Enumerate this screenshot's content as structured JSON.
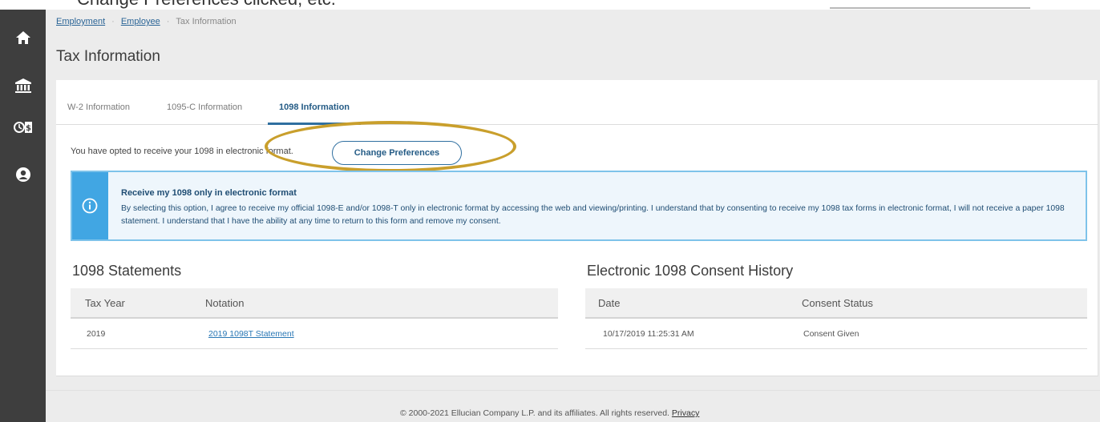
{
  "top_cropped_text": "Change Preferences clicked, etc.",
  "breadcrumb": {
    "items": [
      "Employment",
      "Employee"
    ],
    "current": "Tax Information"
  },
  "page_title": "Tax Information",
  "tabs": [
    {
      "label": "W-2 Information",
      "active": false
    },
    {
      "label": "1095-C Information",
      "active": false
    },
    {
      "label": "1098 Information",
      "active": true
    }
  ],
  "optin": {
    "text": "You have opted to receive your 1098 in electronic format.",
    "button_label": "Change Preferences"
  },
  "info": {
    "icon": "info-icon",
    "title": "Receive my 1098 only in electronic format",
    "body": "By selecting this option, I agree to receive my official 1098-E and/or 1098-T only in electronic format by accessing the web and viewing/printing. I understand that by consenting to receive my 1098 tax forms in electronic format, I will not receive a paper 1098 statement. I understand that I have the ability at any time to return to this form and remove my consent."
  },
  "statements": {
    "title": "1098 Statements",
    "headers": [
      "Tax Year",
      "Notation"
    ],
    "rows": [
      {
        "year": "2019",
        "notation": "2019 1098T Statement"
      }
    ]
  },
  "consent_history": {
    "title": "Electronic 1098 Consent History",
    "headers": [
      "Date",
      "Consent Status"
    ],
    "rows": [
      {
        "date": "10/17/2019 11:25:31 AM",
        "status": "Consent Given"
      }
    ]
  },
  "footer": {
    "text": "© 2000-2021 Ellucian Company L.P. and its affiliates. All rights reserved.",
    "link": "Privacy"
  },
  "sidenav_icons": [
    "home-icon",
    "bank-icon",
    "finance-icon",
    "user-icon"
  ],
  "colors": {
    "nav": "#3e3e3e",
    "canvas": "#ececec",
    "accent": "#2f6fa0",
    "info_bar": "#41a6e3",
    "info_bg": "#eef6fc",
    "highlight": "#c99f2c"
  }
}
